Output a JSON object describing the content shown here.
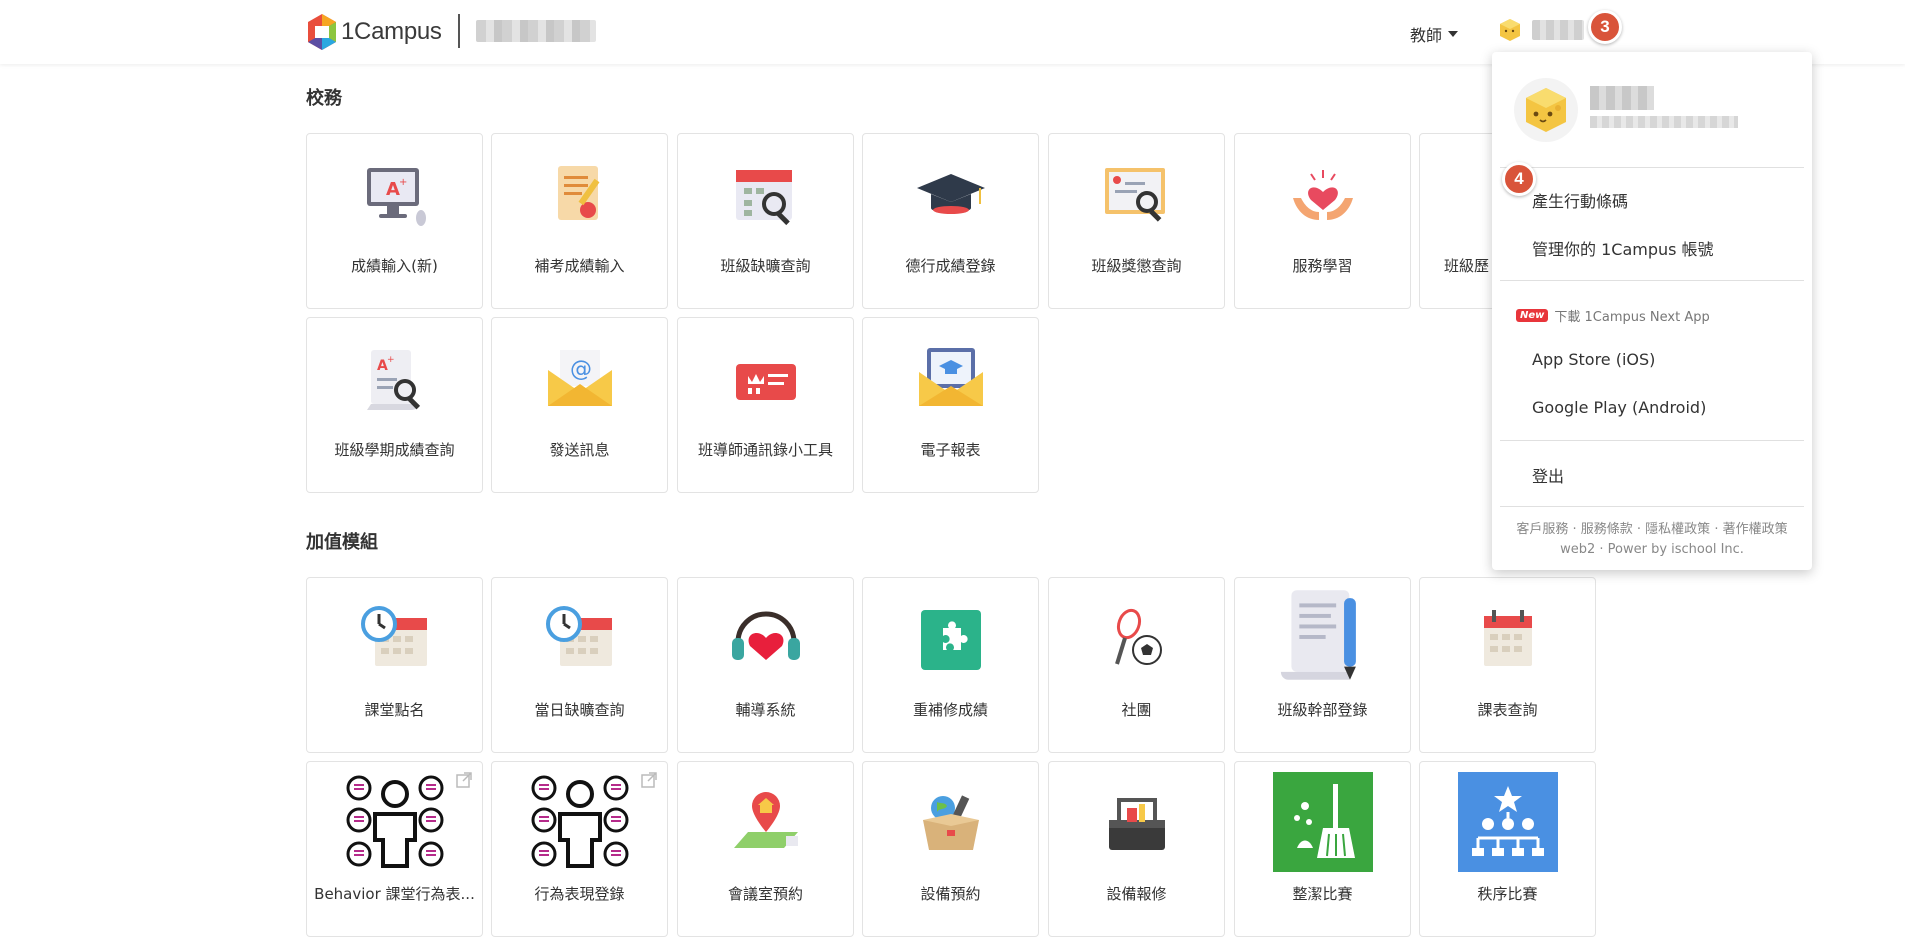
{
  "header": {
    "logo_text": "1Campus",
    "role_label": "教師",
    "step_badge_user": "3"
  },
  "sections": {
    "school": {
      "title": "校務",
      "tiles": [
        {
          "label": "成績輸入(新)",
          "icon": "grade-input-monitor-icon"
        },
        {
          "label": "補考成績輸入",
          "icon": "makeup-exam-document-icon"
        },
        {
          "label": "班級缺曠查詢",
          "icon": "attendance-calendar-search-icon"
        },
        {
          "label": "德行成績登錄",
          "icon": "graduation-cap-icon"
        },
        {
          "label": "班級獎懲查詢",
          "icon": "certificate-search-icon"
        },
        {
          "label": "服務學習",
          "icon": "hands-heart-icon"
        },
        {
          "label": "班級歷",
          "icon": "class-history-icon"
        },
        {
          "label": "班級學期成績查詢",
          "icon": "semester-grade-scroll-search-icon"
        },
        {
          "label": "發送訊息",
          "icon": "email-envelope-icon"
        },
        {
          "label": "班導師通訊錄小工具",
          "icon": "contact-card-icon"
        },
        {
          "label": "電子報表",
          "icon": "report-envelope-icon"
        }
      ]
    },
    "addons": {
      "title": "加值模組",
      "tiles": [
        {
          "label": "課堂點名",
          "icon": "clock-calendar-icon"
        },
        {
          "label": "當日缺曠查詢",
          "icon": "clock-calendar-icon"
        },
        {
          "label": "輔導系統",
          "icon": "headphones-heart-icon"
        },
        {
          "label": "重補修成績",
          "icon": "puzzle-piece-icon"
        },
        {
          "label": "社團",
          "icon": "racket-ball-icon"
        },
        {
          "label": "班級幹部登錄",
          "icon": "scroll-pen-icon"
        },
        {
          "label": "課表查詢",
          "icon": "calendar-icon"
        },
        {
          "label": "Behavior 課堂行為表...",
          "icon": "person-behavior-icon"
        },
        {
          "label": "行為表現登錄",
          "icon": "person-behavior-icon"
        },
        {
          "label": "會議室預約",
          "icon": "map-pin-house-icon"
        },
        {
          "label": "設備預約",
          "icon": "globe-box-icon"
        },
        {
          "label": "設備報修",
          "icon": "toolbox-icon"
        },
        {
          "label": "整潔比賽",
          "icon": "broom-icon"
        },
        {
          "label": "秩序比賽",
          "icon": "hierarchy-star-icon"
        }
      ]
    }
  },
  "dropdown": {
    "step_badge": "4",
    "generate_code": "產生行動條碼",
    "manage_account": "管理你的 1Campus 帳號",
    "new_badge": "New",
    "download_app": "下載 1Campus Next App",
    "app_store": "App Store (iOS)",
    "google_play": "Google Play (Android)",
    "logout": "登出",
    "footer_links": "客戶服務 · 服務條款 · 隱私權政策 · 著作權政策",
    "footer_power": "web2 · Power by ischool Inc."
  },
  "colors": {
    "badge": "#d9543a",
    "new_badge": "#e8353b",
    "puzzle_green": "#2bb38a",
    "broom_green": "#3aa63f",
    "hierarchy_blue": "#4a90e2"
  }
}
